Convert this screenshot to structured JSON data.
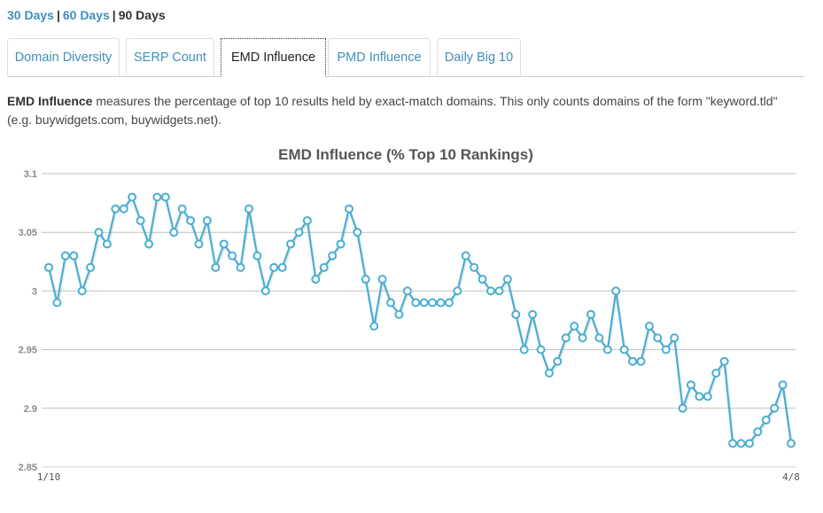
{
  "range_links": [
    {
      "label": "30 Days",
      "active": false
    },
    {
      "label": "60 Days",
      "active": false
    },
    {
      "label": "90 Days",
      "active": true
    }
  ],
  "separator": "|",
  "tabs": [
    {
      "label": "Domain Diversity",
      "active": false
    },
    {
      "label": "SERP Count",
      "active": false
    },
    {
      "label": "EMD Influence",
      "active": true
    },
    {
      "label": "PMD Influence",
      "active": false
    },
    {
      "label": "Daily Big 10",
      "active": false
    }
  ],
  "description": {
    "term": "EMD Influence",
    "text": " measures the percentage of top 10 results held by exact-match domains. This only counts domains of the form \"keyword.tld\" (e.g. buywidgets.com, buywidgets.net)."
  },
  "colors": {
    "link": "#3d8fb8",
    "series": "#4aaed3",
    "grid": "#c0c0c0",
    "axis_text": "#888888"
  },
  "chart_data": {
    "type": "line",
    "title": "EMD Influence (% Top 10 Rankings)",
    "xlabel": "",
    "ylabel": "",
    "ylim": [
      2.85,
      3.1
    ],
    "yticks": [
      2.85,
      2.9,
      2.95,
      3,
      3.05,
      3.1
    ],
    "ytick_labels": [
      "2.85",
      "2.9",
      "2.95",
      "3",
      "3.05",
      "3.1"
    ],
    "x_tick_labels": [
      {
        "index": 0,
        "label": "1/10"
      },
      {
        "index": 89,
        "label": "4/8"
      }
    ],
    "grid": true,
    "legend": "none",
    "series": [
      {
        "name": "EMD Influence",
        "values": [
          3.02,
          2.99,
          3.03,
          3.03,
          3.0,
          3.02,
          3.05,
          3.04,
          3.07,
          3.07,
          3.08,
          3.06,
          3.04,
          3.08,
          3.08,
          3.05,
          3.07,
          3.06,
          3.04,
          3.06,
          3.02,
          3.04,
          3.03,
          3.02,
          3.07,
          3.03,
          3.0,
          3.02,
          3.02,
          3.04,
          3.05,
          3.06,
          3.01,
          3.02,
          3.03,
          3.04,
          3.07,
          3.05,
          3.01,
          2.97,
          3.01,
          2.99,
          2.98,
          3.0,
          2.99,
          2.99,
          2.99,
          2.99,
          2.99,
          3.0,
          3.03,
          3.02,
          3.01,
          3.0,
          3.0,
          3.01,
          2.98,
          2.95,
          2.98,
          2.95,
          2.93,
          2.94,
          2.96,
          2.97,
          2.96,
          2.98,
          2.96,
          2.95,
          3.0,
          2.95,
          2.94,
          2.94,
          2.97,
          2.96,
          2.95,
          2.96,
          2.9,
          2.92,
          2.91,
          2.91,
          2.93,
          2.94,
          2.87,
          2.87,
          2.87,
          2.88,
          2.89,
          2.9,
          2.92,
          2.87
        ]
      }
    ]
  }
}
